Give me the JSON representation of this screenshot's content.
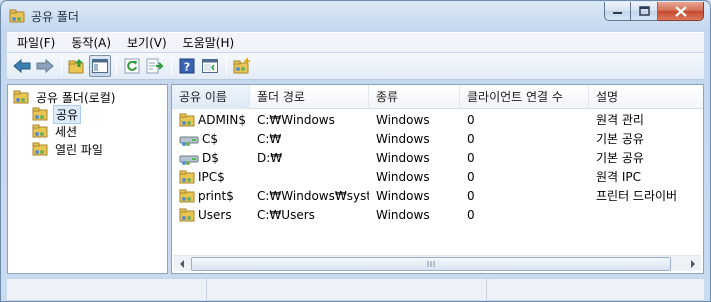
{
  "window": {
    "title": "공유 폴더"
  },
  "menu": [
    "파일(F)",
    "동작(A)",
    "보기(V)",
    "도움말(H)"
  ],
  "toolbar": {
    "icons": [
      "back-arrow-icon",
      "forward-arrow-icon",
      "up-folder-icon",
      "show-hide-console-tree-icon",
      "refresh-icon",
      "export-list-icon",
      "help-icon",
      "show-action-pane-icon",
      "new-share-icon"
    ]
  },
  "tree": {
    "root": "공유 폴더(로컬)",
    "items": [
      "공유",
      "세션",
      "열린 파일"
    ],
    "selected": "공유"
  },
  "list": {
    "columns": [
      "공유 이름",
      "폴더 경로",
      "종류",
      "클라이언트 연결 수",
      "설명"
    ],
    "rows": [
      {
        "name": "ADMIN$",
        "path": "C:₩Windows",
        "type": "Windows",
        "connections": "0",
        "description": "원격 관리",
        "icon": "hidden-share-icon"
      },
      {
        "name": "C$",
        "path": "C:₩",
        "type": "Windows",
        "connections": "0",
        "description": "기본 공유",
        "icon": "drive-share-icon"
      },
      {
        "name": "D$",
        "path": "D:₩",
        "type": "Windows",
        "connections": "0",
        "description": "기본 공유",
        "icon": "drive-share-icon"
      },
      {
        "name": "IPC$",
        "path": "",
        "type": "Windows",
        "connections": "0",
        "description": "원격 IPC",
        "icon": "ipc-share-icon"
      },
      {
        "name": "print$",
        "path": "C:₩Windows₩syst...",
        "type": "Windows",
        "connections": "0",
        "description": "프린터 드라이버",
        "icon": "folder-share-icon"
      },
      {
        "name": "Users",
        "path": "C:₩Users",
        "type": "Windows",
        "connections": "0",
        "description": "",
        "icon": "folder-share-icon"
      }
    ]
  },
  "colors": {
    "accent": "#3c7fb1",
    "selection": "#dcecfc"
  }
}
